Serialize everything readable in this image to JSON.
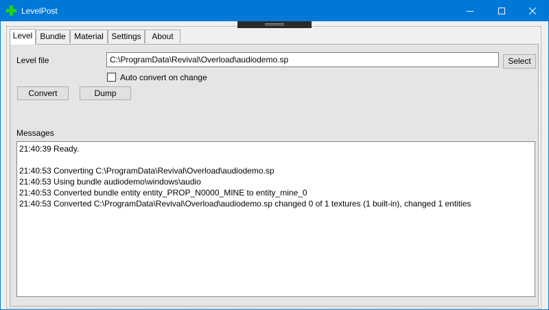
{
  "window": {
    "title": "LevelPost",
    "icon": "green-plus-icon",
    "accent": "#0078d7"
  },
  "tabs": [
    {
      "label": "Level"
    },
    {
      "label": "Bundle"
    },
    {
      "label": "Material"
    },
    {
      "label": "Settings"
    },
    {
      "label": "About"
    }
  ],
  "level": {
    "level_file_label": "Level file",
    "level_file_value": "C:\\ProgramData\\Revival\\Overload\\audiodemo.sp",
    "select_label": "Select",
    "auto_convert_label": "Auto convert on change",
    "auto_convert_checked": false,
    "convert_label": "Convert",
    "dump_label": "Dump",
    "messages_label": "Messages",
    "messages": [
      "21:40:39 Ready.",
      "",
      "21:40:53 Converting C:\\ProgramData\\Revival\\Overload\\audiodemo.sp",
      "21:40:53 Using bundle audiodemo\\windows\\audio",
      "21:40:53 Converted bundle entity entity_PROP_N0000_MINE to entity_mine_0",
      "21:40:53 Converted C:\\ProgramData\\Revival\\Overload\\audiodemo.sp changed 0 of 1 textures (1 built-in), changed 1 entities"
    ]
  }
}
